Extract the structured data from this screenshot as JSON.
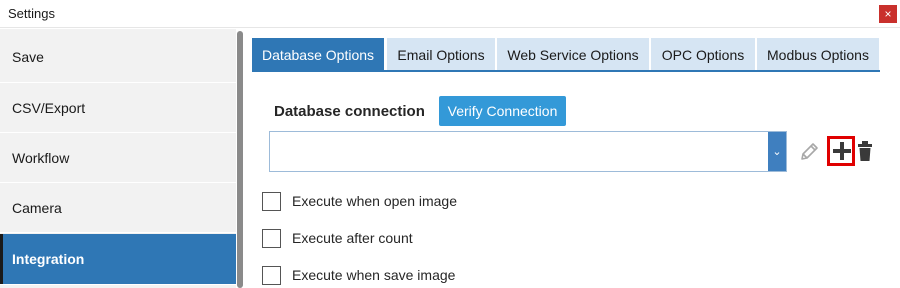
{
  "window": {
    "title": "Settings",
    "close_glyph": "×"
  },
  "sidebar": {
    "items": [
      {
        "label": "Save"
      },
      {
        "label": "CSV/Export"
      },
      {
        "label": "Workflow"
      },
      {
        "label": "Camera"
      },
      {
        "label": "Integration",
        "active": true
      }
    ]
  },
  "tabs": [
    {
      "label": "Database Options",
      "active": true
    },
    {
      "label": "Email Options"
    },
    {
      "label": "Web Service Options"
    },
    {
      "label": "OPC Options"
    },
    {
      "label": "Modbus Options"
    }
  ],
  "database": {
    "label": "Database connection",
    "verify_label": "Verify Connection",
    "connection_value": "",
    "dropdown_glyph": "⌄"
  },
  "checkboxes": [
    {
      "label": "Execute when open image",
      "checked": false
    },
    {
      "label": "Execute after count",
      "checked": false
    },
    {
      "label": "Execute when save image",
      "checked": false
    }
  ],
  "icons": {
    "edit": "pencil-icon",
    "add": "plus-icon",
    "delete": "trash-icon",
    "add_highlight_color": "#e00000"
  },
  "colors": {
    "accent": "#2f77b5",
    "verify_button": "#3399d8",
    "tab_inactive": "#d6e5f3",
    "close_button": "#c9302c"
  }
}
